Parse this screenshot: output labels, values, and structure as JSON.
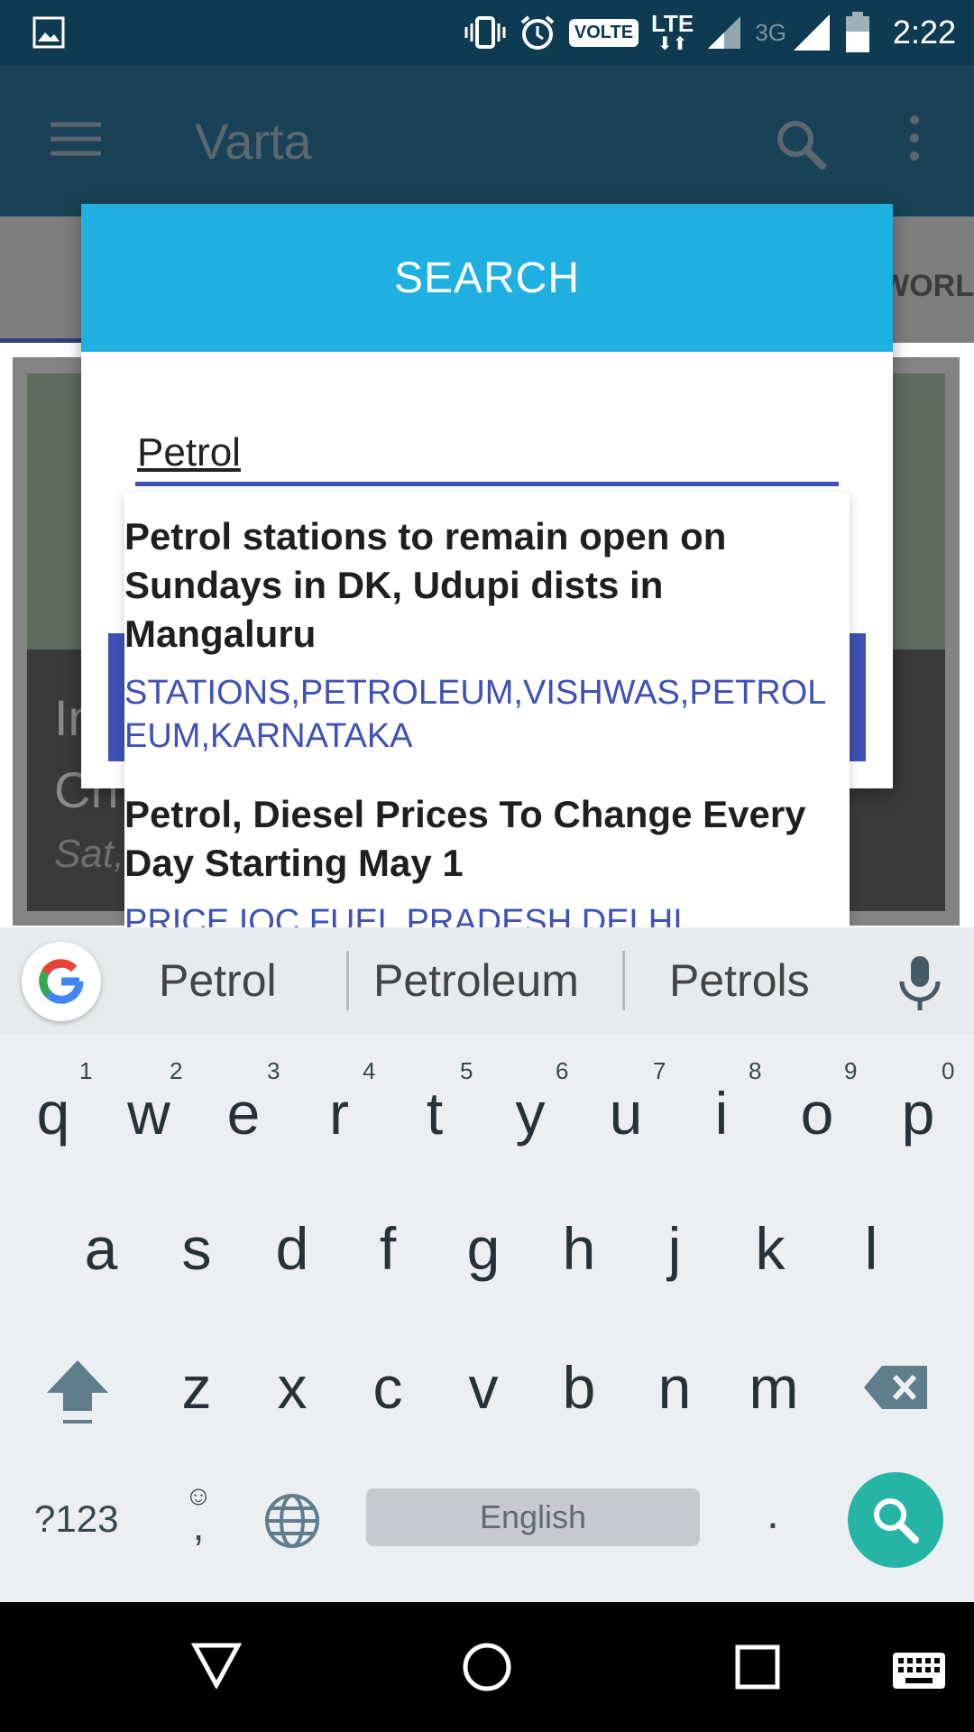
{
  "status_bar": {
    "icons": [
      "gallery-icon",
      "vibrate-icon",
      "alarm-icon",
      "volte-badge",
      "lte-icon",
      "signal-icon",
      "signal-3g-icon",
      "battery-icon"
    ],
    "volte": "VOLTE",
    "lte": "LTE",
    "network_3g": "3G",
    "time": "2:22"
  },
  "app_bar": {
    "title": "Varta",
    "icons": [
      "menu-icon",
      "search-icon",
      "more-vert-icon"
    ]
  },
  "background": {
    "tab_label": "WORL",
    "card_headline_lines": [
      "In",
      "Ch"
    ],
    "card_date": "Sat,"
  },
  "dialog": {
    "title": "SEARCH",
    "input_value": "Petrol"
  },
  "suggestions": [
    {
      "title": "Petrol stations to remain open on Sundays in DK, Udupi dists in Mangaluru",
      "keywords": "STATIONS,PETROLEUM,VISHWAS,PETROLEUM,KARNATAKA"
    },
    {
      "title": "Petrol, Diesel Prices To Change Every Day Starting May 1",
      "keywords": "PRICE,IOC,FUEL,PRADESH,DELHI"
    }
  ],
  "keyboard": {
    "suggestion_words": [
      "Petrol",
      "Petroleum",
      "Petrols"
    ],
    "row1": [
      "q",
      "w",
      "e",
      "r",
      "t",
      "y",
      "u",
      "i",
      "o",
      "p"
    ],
    "row1_hints": [
      "1",
      "2",
      "3",
      "4",
      "5",
      "6",
      "7",
      "8",
      "9",
      "0"
    ],
    "row2": [
      "a",
      "s",
      "d",
      "f",
      "g",
      "h",
      "j",
      "k",
      "l"
    ],
    "row3": [
      "z",
      "x",
      "c",
      "v",
      "b",
      "n",
      "m"
    ],
    "symbols_key": "?123",
    "emoji_comma": ",",
    "space_label": "English",
    "period": ".",
    "colors": {
      "accent": "#26b5a5",
      "background": "#eceff1"
    }
  },
  "nav_bar": {
    "icons": [
      "back-icon",
      "home-icon",
      "recents-icon",
      "keyboard-icon"
    ]
  },
  "colors": {
    "status_bar": "#0e3a52",
    "app_bar": "#1a4257",
    "dialog_header": "#1fb0e1",
    "indigo": "#3f51b5"
  }
}
